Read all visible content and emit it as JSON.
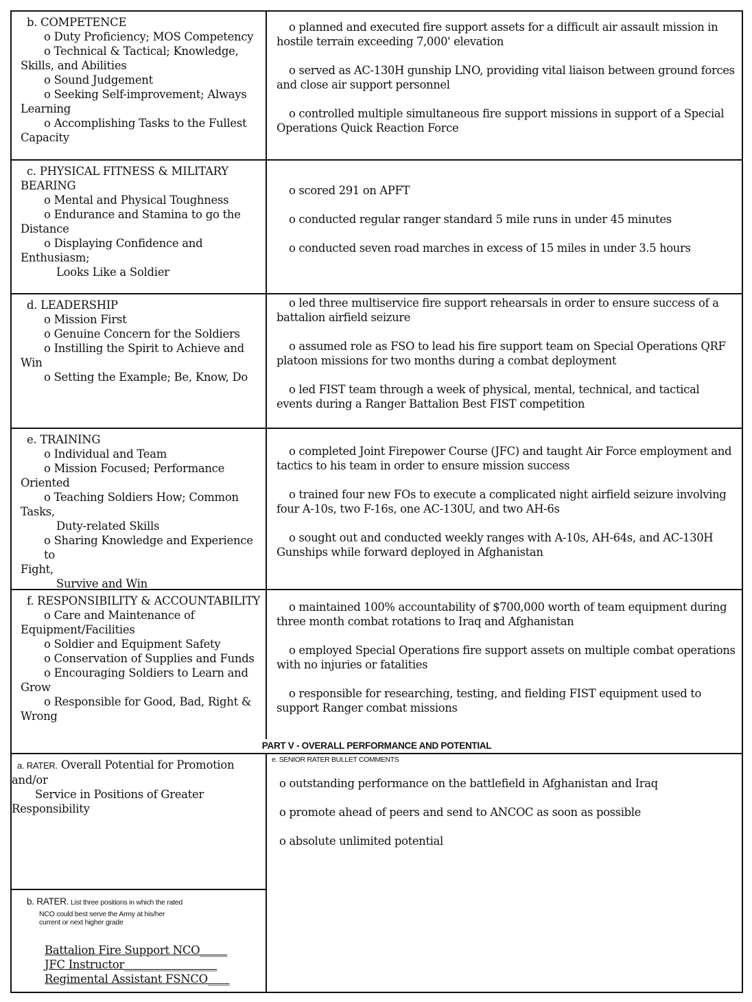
{
  "sections": [
    {
      "heading": "b. COMPETENCE",
      "lines": [
        {
          "type": "item",
          "text": "o Duty Proficiency; MOS Competency"
        },
        {
          "type": "item",
          "text": "o Technical & Tactical; Knowledge,"
        },
        {
          "type": "wrap",
          "text": "Skills, and Abilities"
        },
        {
          "type": "item",
          "text": "o Sound Judgement"
        },
        {
          "type": "item",
          "text": "o Seeking Self-improvement; Always"
        },
        {
          "type": "wrap",
          "text": "Learning"
        },
        {
          "type": "item",
          "text": "o Accomplishing Tasks to the Fullest"
        },
        {
          "type": "wrap",
          "text": "Capacity"
        }
      ],
      "bullets": [
        "o planned and executed fire support assets for a difficult air assault mission in hostile terrain exceeding 7,000' elevation",
        "o served as AC-130H gunship LNO, providing vital liaison between ground forces and close air support personnel",
        "o controlled multiple simultaneous fire support missions in support of a Special Operations Quick Reaction Force"
      ]
    },
    {
      "heading": "c. PHYSICAL FITNESS & MILITARY",
      "lines": [
        {
          "type": "wrap",
          "text": "BEARING"
        },
        {
          "type": "item",
          "text": "o Mental and Physical Toughness"
        },
        {
          "type": "item",
          "text": "o Endurance and Stamina to go the"
        },
        {
          "type": "wrap",
          "text": "Distance"
        },
        {
          "type": "item",
          "text": "o Displaying Confidence and"
        },
        {
          "type": "wrap",
          "text": "Enthusiasm;"
        },
        {
          "type": "cont",
          "text": "Looks Like a Soldier"
        }
      ],
      "bullets": [
        "o scored 291 on APFT",
        "o conducted regular ranger standard 5 mile runs in under 45 minutes",
        "o conducted seven road marches in excess of 15 miles in under 3.5 hours"
      ]
    },
    {
      "heading": "d. LEADERSHIP",
      "lines": [
        {
          "type": "item",
          "text": "o Mission First"
        },
        {
          "type": "item",
          "text": "o Genuine Concern for the Soldiers"
        },
        {
          "type": "item",
          "text": "o Instilling the Spirit to Achieve and"
        },
        {
          "type": "wrap",
          "text": "Win"
        },
        {
          "type": "item",
          "text": "o Setting the Example; Be, Know, Do"
        }
      ],
      "bullets": [
        "o led three multiservice fire support rehearsals in order to ensure success of a battalion airfield seizure",
        "o assumed role as FSO to lead his fire support team on Special Operations QRF platoon missions for two months during a combat deployment",
        "o led FIST team through a week of physical, mental, technical, and tactical events during a Ranger Battalion Best FIST competition"
      ]
    },
    {
      "heading": "e. TRAINING",
      "lines": [
        {
          "type": "item",
          "text": "o Individual and Team"
        },
        {
          "type": "item",
          "text": "o Mission Focused; Performance"
        },
        {
          "type": "wrap",
          "text": "Oriented"
        },
        {
          "type": "item",
          "text": "o Teaching Soldiers How; Common"
        },
        {
          "type": "wrap",
          "text": "Tasks,"
        },
        {
          "type": "cont",
          "text": "Duty-related Skills"
        },
        {
          "type": "item",
          "text": "o Sharing Knowledge and Experience to"
        },
        {
          "type": "wrap",
          "text": "Fight,"
        },
        {
          "type": "cont",
          "text": "Survive and Win"
        }
      ],
      "bullets": [
        "o completed Joint Firepower Course (JFC) and taught Air Force employment and tactics to his team in order to ensure mission success",
        "o trained four new FOs to execute a complicated night airfield seizure involving four A-10s, two F-16s, one AC-130U, and two AH-6s",
        "o sought out and conducted weekly ranges with A-10s, AH-64s, and AC-130H Gunships while forward deployed in Afghanistan"
      ]
    },
    {
      "heading": "f. RESPONSIBILITY & ACCOUNTABILITY",
      "lines": [
        {
          "type": "item",
          "text": "o Care and Maintenance of"
        },
        {
          "type": "wrap",
          "text": "Equipment/Facilities"
        },
        {
          "type": "item",
          "text": "o Soldier and Equipment Safety"
        },
        {
          "type": "item",
          "text": "o Conservation of Supplies and Funds"
        },
        {
          "type": "item",
          "text": "o Encouraging Soldiers to Learn and"
        },
        {
          "type": "wrap",
          "text": "Grow"
        },
        {
          "type": "item",
          "text": "o Responsible for Good, Bad, Right &"
        },
        {
          "type": "wrap",
          "text": "Wrong"
        }
      ],
      "bullets": [
        "o maintained 100% accountability of $700,000 worth of team equipment during three month combat rotations to Iraq and Afghanistan",
        "o employed Special Operations fire support assets on multiple combat operations with no injuries or fatalities",
        "o responsible for researching, testing, and fielding FIST equipment used to support Ranger combat missions"
      ]
    }
  ],
  "part_v": {
    "title": "PART V - OVERALL PERFORMANCE AND POTENTIAL",
    "rater_a": {
      "label_prefix": "a. RATER.",
      "label_text": " Overall Potential for Promotion",
      "line2": "and/or",
      "line3": "Service in Positions of Greater",
      "line4": "Responsibility"
    },
    "rater_b": {
      "label_prefix": "b. RATER.",
      "label_text": " List three positions in which the rated",
      "sub1": "NCO could best serve the Army at his/her",
      "sub2": "current or next higher grade",
      "positions": [
        "Battalion Fire Support NCO_____",
        "JFC Instructor_________________",
        "Regimental Assistant FSNCO____"
      ]
    },
    "senior_rater": {
      "label": "e. SENIOR RATER BULLET COMMENTS",
      "bullets": [
        "o outstanding performance on the battlefield in Afghanistan and Iraq",
        "o promote ahead of peers and send to ANCOC as soon as possible",
        "o absolute unlimited potential"
      ]
    }
  }
}
